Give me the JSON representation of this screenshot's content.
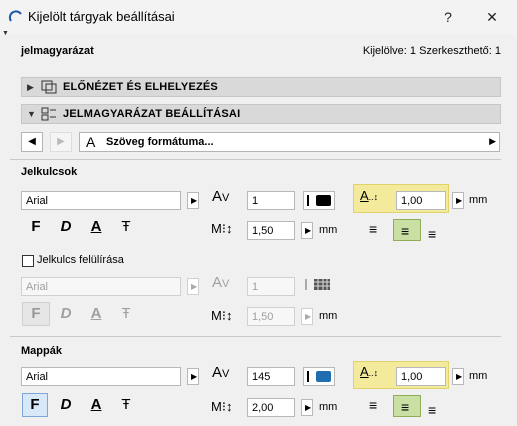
{
  "window": {
    "title": "Kijelölt tárgyak beállításai",
    "help": "?",
    "close": "✕"
  },
  "header": {
    "left": "jelmagyarázat",
    "right": "Kijelölve: 1 Szerkeszthető: 1"
  },
  "sections": {
    "preview": "ELŐNÉZET ÉS ELHELYEZÉS",
    "legend": "JELMAGYARÁZAT BEÁLLÍTÁSAI"
  },
  "page_selector": "Szöveg formátuma...",
  "jelkulcsok": {
    "title": "Jelkulcsok",
    "font": "Arial",
    "size": "1",
    "spacing": "1,00",
    "width": "1,50",
    "unit": "mm"
  },
  "override": {
    "label": "Jelkulcs felülírása",
    "font": "Arial",
    "size": "1",
    "width": "1,50",
    "unit": "mm"
  },
  "mappak": {
    "title": "Mappák",
    "font": "Arial",
    "size": "145",
    "spacing": "1,00",
    "width": "2,00",
    "unit": "mm"
  },
  "colors": {
    "pen_black": "#000000",
    "pen_blue": "#1f6fb0",
    "highlight": "#f4ea9c",
    "align_selected": "#c9dfa3"
  }
}
